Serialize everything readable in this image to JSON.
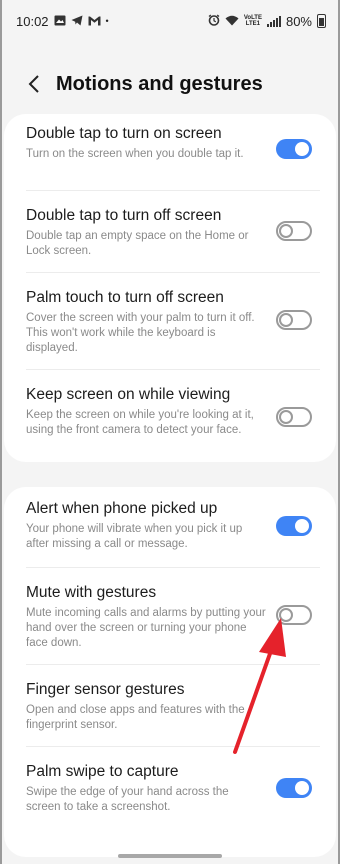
{
  "status_bar": {
    "time": "10:02",
    "left_icons": [
      "gallery-icon",
      "telegram-icon",
      "gmail-icon"
    ],
    "dot": "•",
    "right_icons": [
      "alarm-icon",
      "wifi-icon",
      "volte-icon",
      "signal-icon"
    ],
    "volte_line1": "VoLTE",
    "volte_line2": "LTE1",
    "battery": "80%"
  },
  "header": {
    "title": "Motions and gestures"
  },
  "card1": {
    "items": [
      {
        "title": "Double tap to turn on screen",
        "desc": "Turn on the screen when you double tap it.",
        "toggle": "on"
      },
      {
        "title": "Double tap to turn off screen",
        "desc": "Double tap an empty space on the Home or Lock screen.",
        "toggle": "off"
      },
      {
        "title": "Palm touch to turn off screen",
        "desc": "Cover the screen with your palm to turn it off. This won't work while the keyboard is displayed.",
        "toggle": "off"
      },
      {
        "title": "Keep screen on while viewing",
        "desc": "Keep the screen on while you're looking at it, using the front camera to detect your face.",
        "toggle": "off"
      }
    ]
  },
  "card2": {
    "items": [
      {
        "title": "Alert when phone picked up",
        "desc": "Your phone will vibrate when you pick it up after missing a call or message.",
        "toggle": "on"
      },
      {
        "title": "Mute with gestures",
        "desc": "Mute incoming calls and alarms by putting your hand over the screen or turning your phone face down.",
        "toggle": "off"
      },
      {
        "title": "Finger sensor gestures",
        "desc": "Open and close apps and features with the fingerprint sensor."
      },
      {
        "title": "Palm swipe to capture",
        "desc": "Swipe the edge of your hand across the screen to take a screenshot.",
        "toggle": "on"
      }
    ]
  },
  "annotation": {
    "color": "#e5222b",
    "icon": "red-arrow-icon"
  },
  "colors": {
    "accent": "#3f84f5",
    "background": "#f4f4f4"
  }
}
